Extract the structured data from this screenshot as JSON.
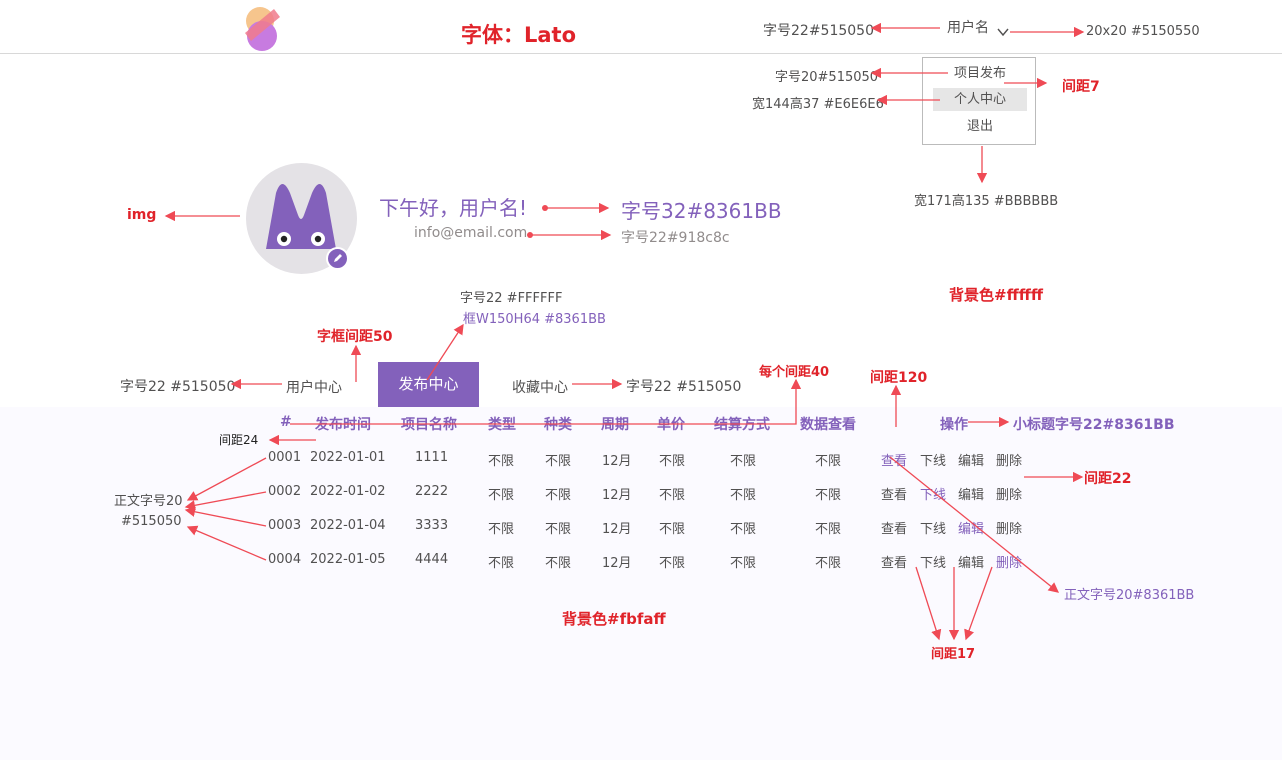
{
  "header": {
    "font_title": "字体：Lato",
    "username": "用户名",
    "note_username_size": "字号22#515050",
    "note_chevron": "20x20 #5150550"
  },
  "dropdown": {
    "items": [
      "项目发布",
      "个人中心",
      "退出"
    ],
    "notes": {
      "item_font": "字号20#515050",
      "item_active": "宽144高37 #E6E6E6",
      "gap": "间距7",
      "box": "宽171高135 #BBBBBB"
    }
  },
  "profile": {
    "greeting": "下午好，用户名!",
    "email": "info@email.com",
    "note_img": "img",
    "note_greeting": "字号32#8361BB",
    "note_email": "字号22#918c8c",
    "note_bg": "背景色#ffffff"
  },
  "tabs": {
    "items": [
      "用户中心",
      "发布中心",
      "收藏中心"
    ],
    "active_index": 1,
    "notes": {
      "btn_font": "字号22 #FFFFFF",
      "btn_box": "框W150H64 #8361BB",
      "gap50": "字框间距50",
      "left_font": "字号22 #515050",
      "right_font": "字号22 #515050",
      "gap40": "每个间距40",
      "gap120": "间距120"
    }
  },
  "table": {
    "headers": [
      "#",
      "发布时间",
      "项目名称",
      "类型",
      "种类",
      "周期",
      "单价",
      "结算方式",
      "数据查看",
      "操作"
    ],
    "rows": [
      [
        "0001",
        "2022-01-01",
        "1111",
        "不限",
        "不限",
        "12月",
        "不限",
        "不限",
        "不限"
      ],
      [
        "0002",
        "2022-01-02",
        "2222",
        "不限",
        "不限",
        "12月",
        "不限",
        "不限",
        "不限"
      ],
      [
        "0003",
        "2022-01-04",
        "3333",
        "不限",
        "不限",
        "12月",
        "不限",
        "不限",
        "不限"
      ],
      [
        "0004",
        "2022-01-05",
        "4444",
        "不限",
        "不限",
        "12月",
        "不限",
        "不限",
        "不限"
      ]
    ],
    "actions": [
      "查看",
      "下线",
      "编辑",
      "删除"
    ],
    "notes": {
      "header_font": "小标题字号22#8361BB",
      "gap24": "间距24",
      "body_font_1": "正文字号20",
      "body_font_2": "#515050",
      "gap22": "间距22",
      "action_hl": "正文字号20#8361BB",
      "gap17": "间距17",
      "bg": "背景色#fbfaff"
    }
  },
  "colors": {
    "accent": "#8361BB",
    "text": "#515050",
    "annotation": "#e0232a",
    "arrow": "#ef4a55"
  }
}
